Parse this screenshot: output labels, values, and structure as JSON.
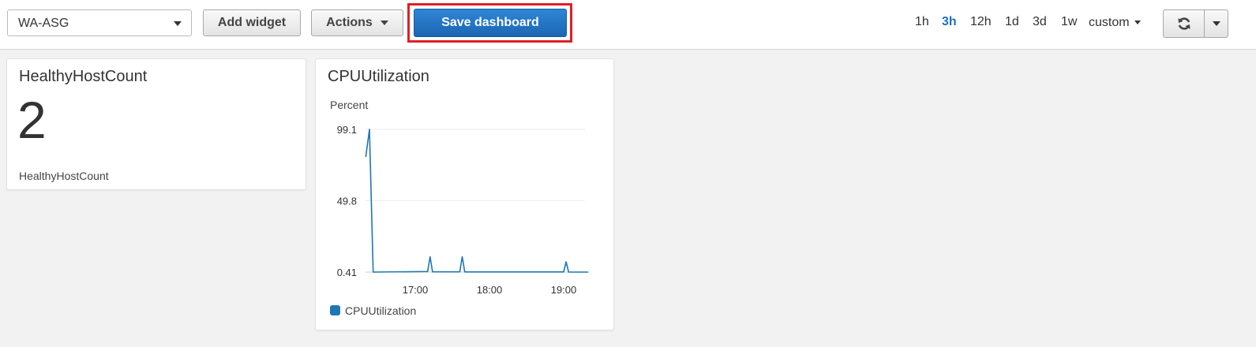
{
  "toolbar": {
    "dashboard_select": "WA-ASG",
    "add_widget": "Add widget",
    "actions": "Actions",
    "save_dashboard": "Save dashboard",
    "time_ranges": [
      "1h",
      "3h",
      "12h",
      "1d",
      "3d",
      "1w"
    ],
    "active_range": "3h",
    "custom": "custom",
    "refresh_icon": "refresh-icon",
    "dropdown_icon": "chevron-down-icon"
  },
  "colors": {
    "accent": "#1f6fbd",
    "save_button": "#1b66b3",
    "highlight_outline": "#e01f26",
    "series": "#1f77b4"
  },
  "widgets": {
    "healthy": {
      "title": "HealthyHostCount",
      "value": "2",
      "label": "HealthyHostCount"
    },
    "cpu": {
      "title": "CPUUtilization",
      "unit": "Percent",
      "legend": "CPUUtilization"
    }
  },
  "chart_data": {
    "type": "line",
    "title": "CPUUtilization",
    "ylabel": "Percent",
    "xlabel": "",
    "ylim": [
      0.41,
      99.1
    ],
    "yticks": [
      "99.1",
      "49.8",
      "0.41"
    ],
    "xticks": [
      "17:00",
      "18:00",
      "19:00"
    ],
    "grid": true,
    "legend_position": "bottom-left",
    "series": [
      {
        "name": "CPUUtilization",
        "x": [
          "16:20",
          "16:23",
          "16:26",
          "17:10",
          "17:12",
          "17:14",
          "17:36",
          "17:38",
          "17:40",
          "19:00",
          "19:02",
          "19:04",
          "19:20"
        ],
        "values": [
          80,
          99.1,
          0.41,
          0.8,
          11,
          0.6,
          0.6,
          11,
          0.5,
          0.5,
          7.5,
          0.41,
          0.41
        ]
      }
    ]
  }
}
